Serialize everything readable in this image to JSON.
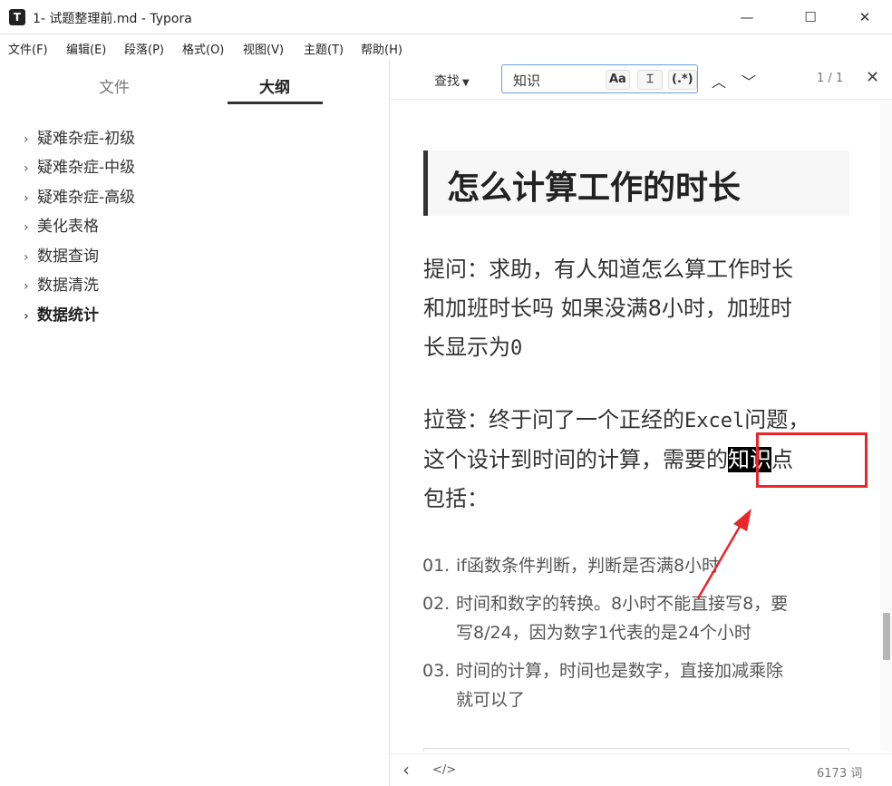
{
  "window": {
    "app_icon": "T",
    "title": "1- 试题整理前.md - Typora",
    "minimize": "—",
    "maximize": "☐",
    "close": "✕"
  },
  "menu": [
    "文件(F)",
    "编辑(E)",
    "段落(P)",
    "格式(O)",
    "视图(V)",
    "主题(T)",
    "帮助(H)"
  ],
  "sidebar": {
    "tabs": [
      {
        "label": "文件",
        "active": false
      },
      {
        "label": "大纲",
        "active": true
      }
    ],
    "outline": [
      {
        "label": "疑难杂症-初级",
        "bold": false
      },
      {
        "label": "疑难杂症-中级",
        "bold": false
      },
      {
        "label": "疑难杂症-高级",
        "bold": false
      },
      {
        "label": "美化表格",
        "bold": false
      },
      {
        "label": "数据查询",
        "bold": false
      },
      {
        "label": "数据清洗",
        "bold": false
      },
      {
        "label": "数据统计",
        "bold": true
      }
    ]
  },
  "findbar": {
    "mode_label": "查找",
    "query": "知识",
    "opt_case": "Aa",
    "opt_word": "⌶",
    "opt_regex": "(.*)",
    "prev_icon": "︿",
    "next_icon": "﹀",
    "count": "1 / 1",
    "close_icon": "✕"
  },
  "doc": {
    "heading": "怎么计算工作的时长",
    "question_line1": "提问：求助，有人知道怎么算工作时长",
    "question_line2": "和加班时长吗  如果没满8小时，加班时",
    "question_line3a": "长显示为",
    "question_line3b": "0",
    "answer_line1a": "拉登：终于问了一个正经的",
    "answer_line1b": "Excel",
    "answer_line1c": "问题，",
    "answer_line2a": "这个设计到时间的计算，需要的",
    "answer_line2b": "知识",
    "answer_line2c": "点",
    "answer_line3": "包括：",
    "list": [
      {
        "num": "01.",
        "lines": [
          "if函数条件判断，判断是否满8小时"
        ]
      },
      {
        "num": "02.",
        "lines": [
          "时间和数字的转换。8小时不能直接写8，要",
          "写8/24，因为数字1代表的是24个小时"
        ]
      },
      {
        "num": "03.",
        "lines": [
          "时间的计算，时间也是数字，直接加减乘除",
          "就可以了"
        ]
      }
    ]
  },
  "status": {
    "back_icon": "‹",
    "source_icon": "</>",
    "word_count": "6173 词"
  },
  "colors": {
    "annotation": "#e8262b",
    "highlight_bg": "#000000",
    "focus_border": "#6aa0e0"
  }
}
